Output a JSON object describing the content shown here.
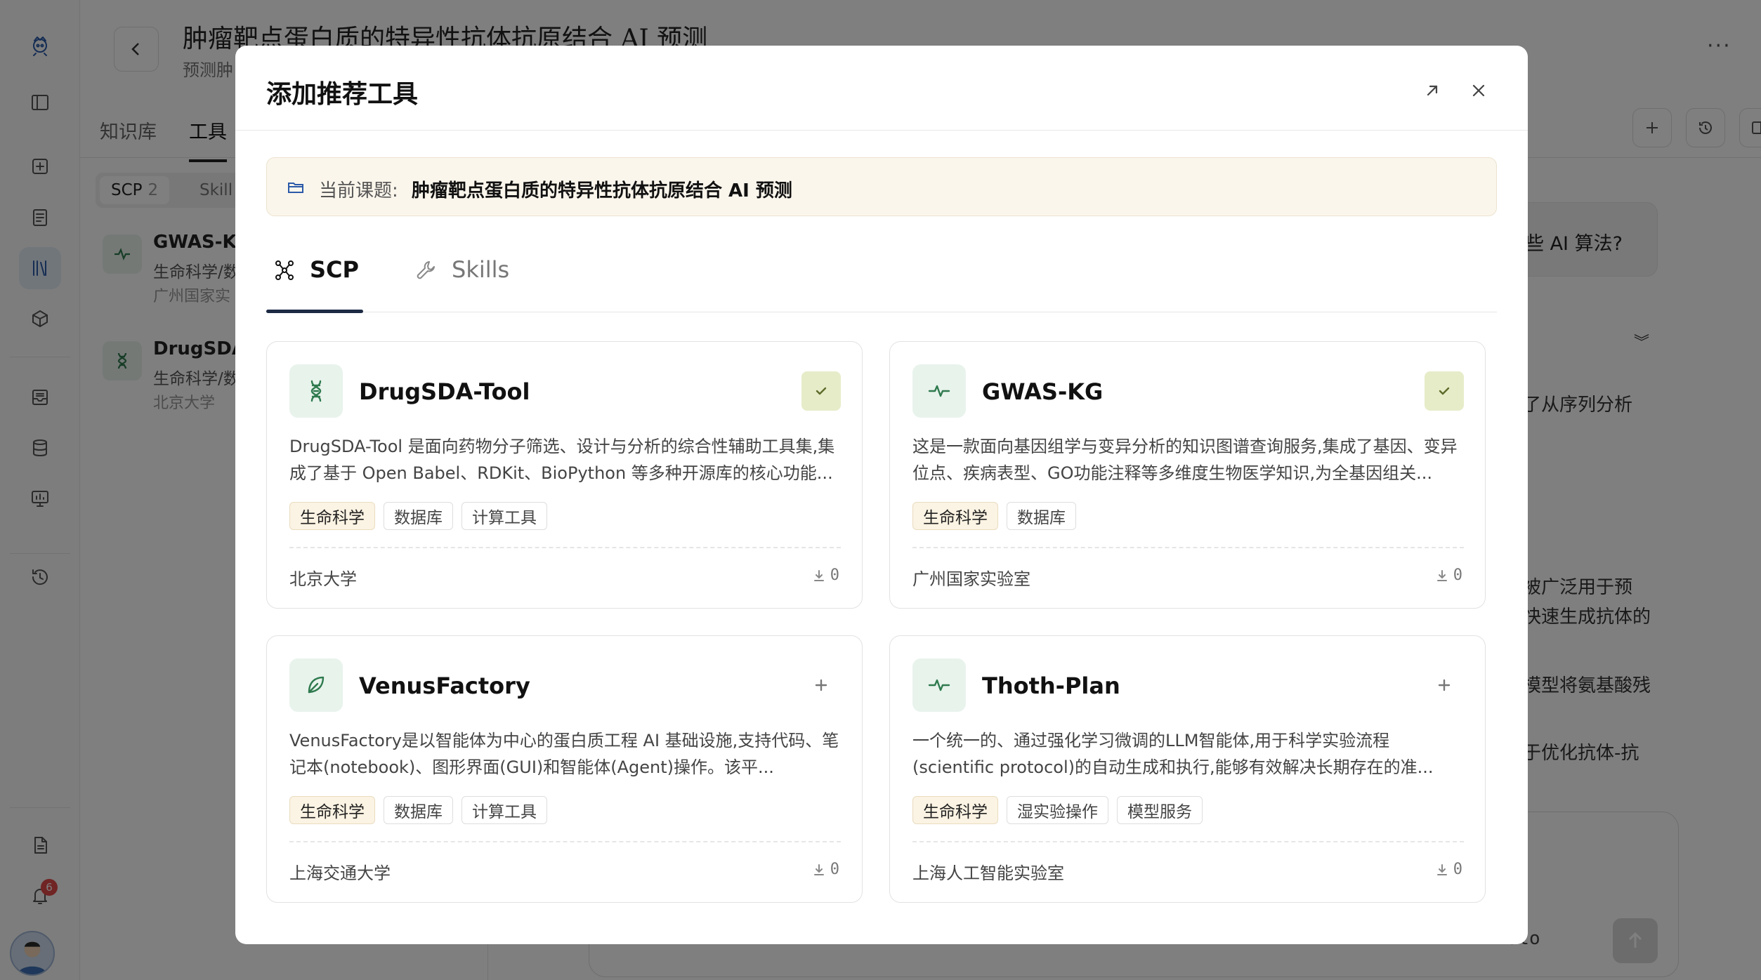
{
  "app": {
    "page_title": "肿瘤靶点蛋白质的特异性抗体抗原结合 AI 预测",
    "page_subtitle": "预测肿",
    "more_label": "···",
    "left_tabs": [
      {
        "label": "知识库",
        "active": false
      },
      {
        "label": "工具",
        "active": true
      }
    ],
    "segment": {
      "scp_label": "SCP",
      "scp_count": "2",
      "skills_label": "Skill"
    },
    "left_items": [
      {
        "name": "GWAS-KG",
        "category": "生命科学/数",
        "org": "广州国家实"
      },
      {
        "name": "DrugSDA",
        "category": "生命科学/数",
        "org": "北京大学"
      }
    ],
    "notification_count": "6",
    "chat_bubble_text": "些 AI 算法?",
    "background_lines": [
      "了从序列分析",
      "被广泛用于预",
      "快速生成抗体的",
      "模型将氨基酸残",
      "于优化抗体-抗"
    ],
    "composer_mode": "Auto"
  },
  "modal": {
    "title": "添加推荐工具",
    "topic_label": "当前课题:",
    "topic_value": "肿瘤靶点蛋白质的特异性抗体抗原结合 AI 预测",
    "tabs": [
      {
        "label": "SCP",
        "icon": "network-icon",
        "active": true
      },
      {
        "label": "Skills",
        "icon": "wrench-icon",
        "active": false
      }
    ],
    "cards": [
      {
        "name": "DrugSDA-Tool",
        "icon": "dna-icon",
        "added": true,
        "description": "DrugSDA-Tool 是面向药物分子筛选、设计与分析的综合性辅助工具集,集成了基于 Open Babel、RDKit、BioPython 等多种开源库的核心功能...",
        "tags": [
          "生命科学",
          "数据库",
          "计算工具"
        ],
        "org": "北京大学",
        "downloads": "0"
      },
      {
        "name": "GWAS-KG",
        "icon": "pulse-icon",
        "added": true,
        "description": "这是一款面向基因组学与变异分析的知识图谱查询服务,集成了基因、变异位点、疾病表型、GO功能注释等多维度生物医学知识,为全基因组关...",
        "tags": [
          "生命科学",
          "数据库"
        ],
        "org": "广州国家实验室",
        "downloads": "0"
      },
      {
        "name": "VenusFactory",
        "icon": "leaf-icon",
        "added": false,
        "description": "VenusFactory是以智能体为中心的蛋白质工程 AI 基础设施,支持代码、笔记本(notebook)、图形界面(GUI)和智能体(Agent)操作。该平...",
        "tags": [
          "生命科学",
          "数据库",
          "计算工具"
        ],
        "org": "上海交通大学",
        "downloads": "0"
      },
      {
        "name": "Thoth-Plan",
        "icon": "pulse-icon",
        "added": false,
        "description": "一个统一的、通过强化学习微调的LLM智能体,用于科学实验流程(scientific protocol)的自动生成和执行,能够有效解决长期存在的准...",
        "tags": [
          "生命科学",
          "湿实验操作",
          "模型服务"
        ],
        "org": "上海人工智能实验室",
        "downloads": "0"
      }
    ]
  }
}
